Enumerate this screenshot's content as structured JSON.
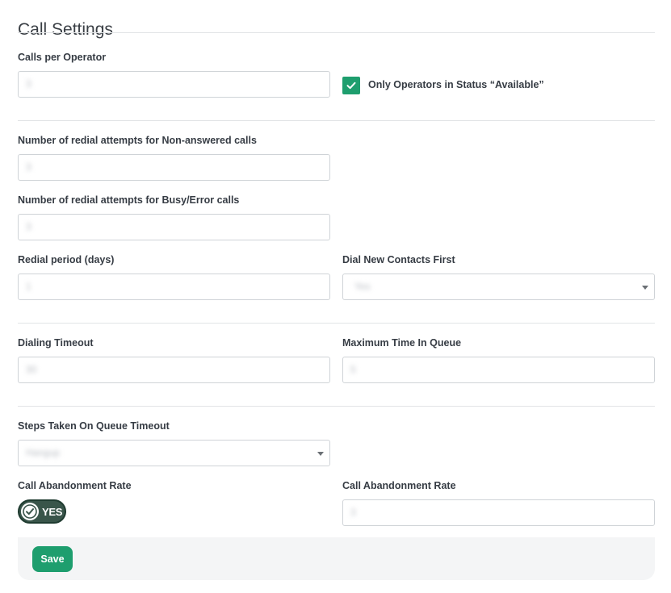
{
  "page": {
    "title": "Call Settings"
  },
  "calls_per_operator": {
    "label": "Calls per Operator",
    "value": "3"
  },
  "only_available": {
    "label": "Only Operators in Status “Available”",
    "checked": true
  },
  "redial_non_answered": {
    "label": "Number of redial attempts for Non-answered calls",
    "value": "3"
  },
  "redial_busy_error": {
    "label": "Number of redial attempts for Busy/Error calls",
    "value": "3"
  },
  "redial_period": {
    "label": "Redial period (days)",
    "value": "1"
  },
  "dial_new_first": {
    "label": "Dial New Contacts First",
    "value": "Yes"
  },
  "dialing_timeout": {
    "label": "Dialing Timeout",
    "value": "30"
  },
  "max_time_in_queue": {
    "label": "Maximum Time In Queue",
    "value": "5"
  },
  "queue_timeout_steps": {
    "label": "Steps Taken On Queue Timeout",
    "value": "Hangup"
  },
  "abandonment_toggle": {
    "label": "Call Abandonment Rate",
    "state_text": "YES",
    "on": true
  },
  "abandonment_rate": {
    "label": "Call Abandonment Rate",
    "value": "3"
  },
  "footer": {
    "save_label": "Save"
  },
  "colors": {
    "accent": "#1e9e6e",
    "toggle_bg": "#39554a"
  },
  "icons": {
    "checkbox": "check-icon",
    "select": "caret-down-icon",
    "toggle": "check-circle-icon"
  }
}
